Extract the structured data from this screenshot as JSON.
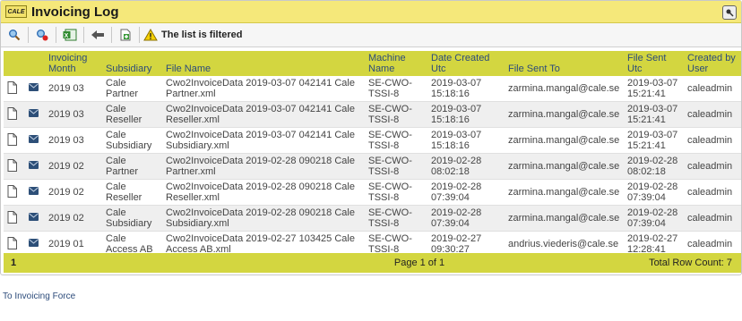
{
  "window": {
    "title": "Invoicing Log",
    "logo_text": "CALE",
    "close_icon": "pin-icon"
  },
  "toolbar": {
    "filter_status": "The list is filtered"
  },
  "table": {
    "headers": [
      "Invoicing Month",
      "Subsidiary",
      "File Name",
      "Machine Name",
      "Date Created Utc",
      "File Sent To",
      "File Sent Utc",
      "Created by User"
    ],
    "rows": [
      {
        "month": "2019 03",
        "subsidiary": "Cale Partner",
        "file": "Cwo2InvoiceData 2019-03-07 042141 Cale Partner.xml",
        "machine": "SE-CWO-TSSI-8",
        "created": "2019-03-07 15:18:16",
        "sent_to": "zarmina.mangal@cale.se",
        "sent": "2019-03-07 15:21:41",
        "user": "caleadmin"
      },
      {
        "month": "2019 03",
        "subsidiary": "Cale Reseller",
        "file": "Cwo2InvoiceData 2019-03-07 042141 Cale Reseller.xml",
        "machine": "SE-CWO-TSSI-8",
        "created": "2019-03-07 15:18:16",
        "sent_to": "zarmina.mangal@cale.se",
        "sent": "2019-03-07 15:21:41",
        "user": "caleadmin"
      },
      {
        "month": "2019 03",
        "subsidiary": "Cale Subsidiary",
        "file": "Cwo2InvoiceData 2019-03-07 042141 Cale Subsidiary.xml",
        "machine": "SE-CWO-TSSI-8",
        "created": "2019-03-07 15:18:16",
        "sent_to": "zarmina.mangal@cale.se",
        "sent": "2019-03-07 15:21:41",
        "user": "caleadmin"
      },
      {
        "month": "2019 02",
        "subsidiary": "Cale Partner",
        "file": "Cwo2InvoiceData 2019-02-28 090218 Cale Partner.xml",
        "machine": "SE-CWO-TSSI-8",
        "created": "2019-02-28 08:02:18",
        "sent_to": "zarmina.mangal@cale.se",
        "sent": "2019-02-28 08:02:18",
        "user": "caleadmin"
      },
      {
        "month": "2019 02",
        "subsidiary": "Cale Reseller",
        "file": "Cwo2InvoiceData 2019-02-28 090218 Cale Reseller.xml",
        "machine": "SE-CWO-TSSI-8",
        "created": "2019-02-28 07:39:04",
        "sent_to": "zarmina.mangal@cale.se",
        "sent": "2019-02-28 07:39:04",
        "user": "caleadmin"
      },
      {
        "month": "2019 02",
        "subsidiary": "Cale Subsidiary",
        "file": "Cwo2InvoiceData 2019-02-28 090218 Cale Subsidiary.xml",
        "machine": "SE-CWO-TSSI-8",
        "created": "2019-02-28 07:39:04",
        "sent_to": "zarmina.mangal@cale.se",
        "sent": "2019-02-28 07:39:04",
        "user": "caleadmin"
      },
      {
        "month": "2019 01",
        "subsidiary": "Cale Access AB",
        "file": "Cwo2InvoiceData 2019-02-27 103425 Cale Access AB.xml",
        "machine": "SE-CWO-TSSI-8",
        "created": "2019-02-27 09:30:27",
        "sent_to": "andrius.viederis@cale.se",
        "sent": "2019-02-27 12:28:41",
        "user": "caleadmin"
      }
    ]
  },
  "footer": {
    "current_page": "1",
    "page_info": "Page 1 of 1",
    "row_count": "Total Row Count: 7"
  },
  "link": {
    "text": "To Invoicing Force"
  },
  "colors": {
    "title_bar": "#f5e87a",
    "header_bg": "#d3d640",
    "header_text": "#2c4b7a"
  }
}
